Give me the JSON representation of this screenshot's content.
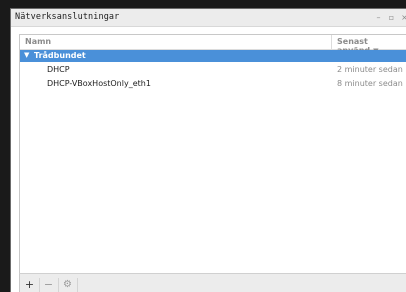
{
  "window": {
    "title": "Nätverksanslutningar",
    "minimize_glyph": "–",
    "maximize_glyph": "▫",
    "close_glyph": "×"
  },
  "list": {
    "columns": {
      "name": "Namn",
      "last_used": "Senast använd",
      "sort_glyph": "▼"
    },
    "groups": [
      {
        "label": "Trådbundet",
        "expander_glyph": "▼",
        "connections": [
          {
            "name": "DHCP",
            "last_used": "2 minuter sedan"
          },
          {
            "name": "DHCP-VBoxHostOnly_eth1",
            "last_used": "8 minuter sedan"
          }
        ]
      }
    ]
  },
  "toolbar": {
    "add_glyph": "+",
    "remove_glyph": "−",
    "settings_glyph": "⚙"
  },
  "colors": {
    "selection": "#4a90d9",
    "muted_text": "#8b8b8b"
  }
}
